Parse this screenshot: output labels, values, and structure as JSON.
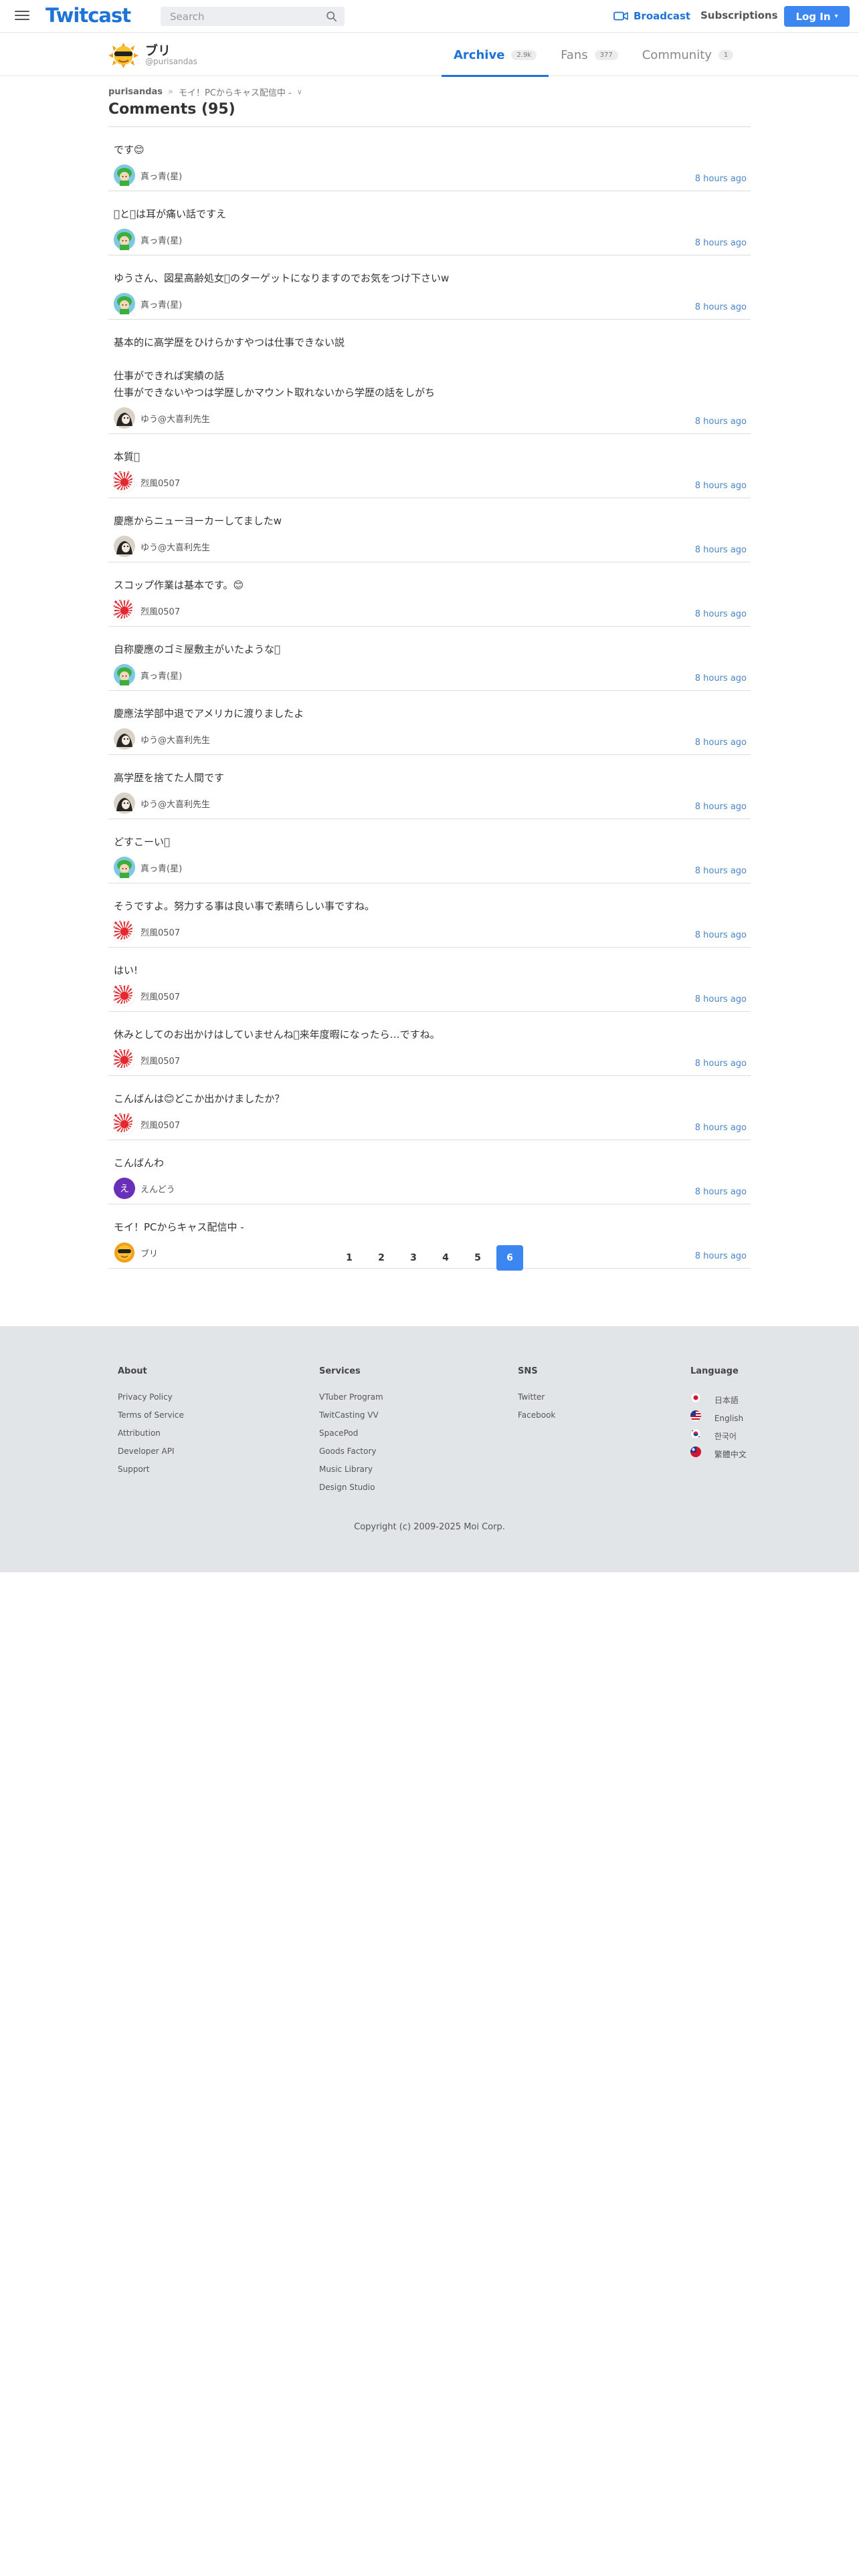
{
  "header": {
    "logo": "Twitcast",
    "search_placeholder": "Search",
    "broadcast_label": "Broadcast",
    "subscriptions_label": "Subscriptions",
    "login_label": "Log In",
    "accent_color": "#3b86f0"
  },
  "profile": {
    "name": "ブリ",
    "handle": "@purisandas",
    "tabs": [
      {
        "label": "Archive",
        "count": "2.9k",
        "active": true
      },
      {
        "label": "Fans",
        "count": "377",
        "active": false
      },
      {
        "label": "Community",
        "count": "1",
        "active": false
      }
    ]
  },
  "breadcrumb": {
    "user": "purisandas",
    "separator": "»",
    "movie": "モイ！PCからキャス配信中 -",
    "caret": "∨"
  },
  "comments_title": "Comments (95)",
  "comments": [
    {
      "text": "です😊",
      "author": "真っ青(星)",
      "avatar": "green-fairy",
      "time": "8 hours ago"
    },
    {
      "text": "􏰀と􏰀は耳が痛い話ですえ",
      "author": "真っ青(星)",
      "avatar": "green-fairy",
      "time": "8 hours ago"
    },
    {
      "text": "ゆうさん、図星高齢処女􏰀のターゲットになりますのでお気をつけ下さいw",
      "author": "真っ青(星)",
      "avatar": "green-fairy",
      "time": "8 hours ago"
    },
    {
      "text": "基本的に高学歴をひけらかすやつは仕事できない説\n\n仕事ができれば実績の話\n仕事ができないやつは学歴しかマウント取れないから学歴の話をしがち",
      "author": "ゆう@大喜利先生",
      "avatar": "dark-cat",
      "time": "8 hours ago"
    },
    {
      "text": "本質􏰀",
      "author": "烈風0507",
      "avatar": "rising-sun",
      "time": "8 hours ago"
    },
    {
      "text": "慶應からニューヨーカーしてましたw",
      "author": "ゆう@大喜利先生",
      "avatar": "dark-cat",
      "time": "8 hours ago"
    },
    {
      "text": "スコップ作業は基本です。😊",
      "author": "烈風0507",
      "avatar": "rising-sun",
      "time": "8 hours ago"
    },
    {
      "text": "自称慶應のゴミ屋敷主がいたような􏰀",
      "author": "真っ青(星)",
      "avatar": "green-fairy",
      "time": "8 hours ago"
    },
    {
      "text": "慶應法学部中退でアメリカに渡りましたよ",
      "author": "ゆう@大喜利先生",
      "avatar": "dark-cat",
      "time": "8 hours ago"
    },
    {
      "text": "高学歴を捨てた人間です",
      "author": "ゆう@大喜利先生",
      "avatar": "dark-cat",
      "time": "8 hours ago"
    },
    {
      "text": "どすこーい􏰀",
      "author": "真っ青(星)",
      "avatar": "green-fairy",
      "time": "8 hours ago"
    },
    {
      "text": "そうですよ。努力する事は良い事で素晴らしい事ですね。",
      "author": "烈風0507",
      "avatar": "rising-sun",
      "time": "8 hours ago"
    },
    {
      "text": "はい!",
      "author": "烈風0507",
      "avatar": "rising-sun",
      "time": "8 hours ago"
    },
    {
      "text": "休みとしてのお出かけはしていませんね􏰀来年度暇になったら…ですね。",
      "author": "烈風0507",
      "avatar": "rising-sun",
      "time": "8 hours ago"
    },
    {
      "text": "こんばんは😊どこか出かけましたか？",
      "author": "烈風0507",
      "avatar": "rising-sun",
      "time": "8 hours ago"
    },
    {
      "text": "こんばんわ",
      "author": "えんどう",
      "avatar": "purple-letter",
      "avatar_letter": "え",
      "time": "8 hours ago"
    },
    {
      "text": "モイ！PCからキャス配信中 -",
      "author": "ブリ",
      "avatar": "sun-sunglasses",
      "time": "8 hours ago"
    }
  ],
  "pagination": {
    "pages": [
      "1",
      "2",
      "3",
      "4",
      "5",
      "6"
    ],
    "current": "6"
  },
  "footer": {
    "about": {
      "title": "About",
      "links": [
        "Privacy Policy",
        "Terms of Service",
        "Attribution",
        "Developer API",
        "Support"
      ]
    },
    "services": {
      "title": "Services",
      "links": [
        "VTuber Program",
        "TwitCasting VV",
        "SpacePod",
        "Goods Factory",
        "Music Library",
        "Design Studio"
      ]
    },
    "sns": {
      "title": "SNS",
      "links": [
        "Twitter",
        "Facebook"
      ]
    },
    "language": {
      "title": "Language",
      "links": [
        "日本語",
        "English",
        "한국어",
        "繁體中文"
      ]
    },
    "copyright": "Copyright (c) 2009-2025 Moi Corp."
  }
}
